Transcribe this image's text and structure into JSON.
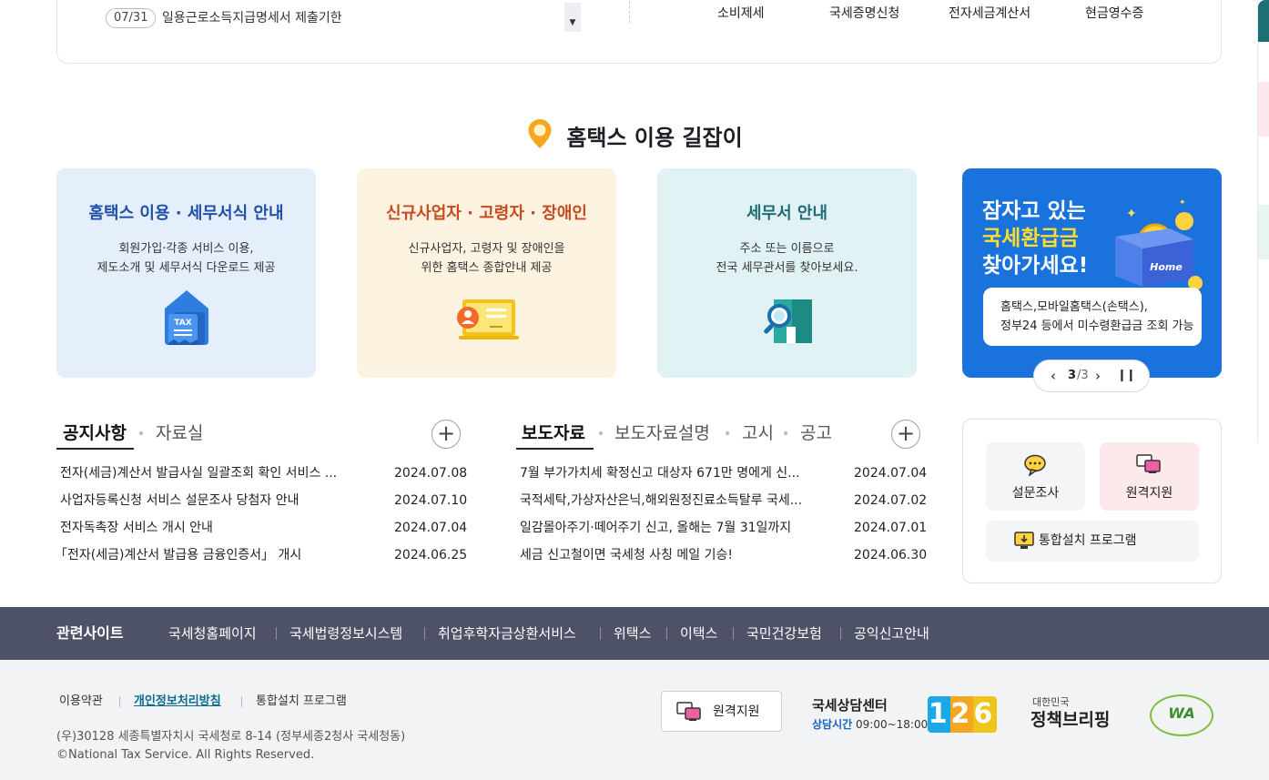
{
  "schedule": {
    "date": "07/31",
    "text": "일용근로소득지급명세서 제출기한",
    "scroll_icon": "triangle-down"
  },
  "top_links": [
    "소비제세",
    "국세증명신청",
    "전자세금계산서",
    "현금영수증"
  ],
  "guide": {
    "title": "홈택스 이용 길잡이",
    "icon": "map-pin-icon",
    "cards": [
      {
        "title": "홈택스 이용 · 세무서식 안내",
        "desc": "회원가입·각종 서비스 이용,\n제도소개 및 세무서식 다운로드 제공",
        "title_color": "#1f4fa8",
        "bg": "#e4effb",
        "icon": "tax-document-icon",
        "icon_text": "TAX"
      },
      {
        "title": "신규사업자 · 고령자 · 장애인",
        "desc": "신규사업자, 고령자 및 장애인을\n위한 홈택스 종합안내 제공",
        "title_color": "#c74b1e",
        "bg": "#fbf3df",
        "icon": "monitor-person-icon"
      },
      {
        "title": "세무서 안내",
        "desc": "주소 또는 이름으로\n전국 세무관서를 찾아보세요.",
        "title_color": "#1f6b77",
        "bg": "#e0f2f3",
        "icon": "building-search-icon"
      }
    ]
  },
  "banner": {
    "line1": "잠자고 있는",
    "line2": "국세환급금",
    "line3": "찾아가세요!",
    "box_text": "홈택스,모바일홈택스(손택스),\n정부24 등에서 미수령환급금 조회 가능",
    "icon": "coin-box-icon",
    "home_label": "Home",
    "pager": {
      "current": "3",
      "total": "/3"
    },
    "colors": {
      "bg": "#1a73dc",
      "highlight": "#ffdd2a"
    }
  },
  "notice_board": {
    "tabs": [
      "공지사항",
      "자료실"
    ],
    "rows": [
      {
        "title": "전자(세금)계산서 발급사실 일괄조회 확인 서비스 ...",
        "date": "2024.07.08"
      },
      {
        "title": "사업자등록신청 서비스 설문조사 당첨자 안내",
        "date": "2024.07.10"
      },
      {
        "title": "전자독촉장 서비스 개시 안내",
        "date": "2024.07.04"
      },
      {
        "title": "「전자(세금)계산서 발급용 금융인증서」 개시",
        "date": "2024.06.25"
      }
    ]
  },
  "press_board": {
    "tabs": [
      "보도자료",
      "보도자료설명",
      "고시",
      "공고"
    ],
    "rows": [
      {
        "title": "7월 부가가치세 확정신고 대상자 671만 명에게 신...",
        "date": "2024.07.04"
      },
      {
        "title": "국적세탁,가상자산은닉,해외원정진료소득탈루 국세...",
        "date": "2024.07.02"
      },
      {
        "title": "일감몰아주기·떼어주기 신고, 올해는 7월 31일까지",
        "date": "2024.07.01"
      },
      {
        "title": "세금 신고철이면 국세청 사칭 메일 기승!",
        "date": "2024.06.30"
      }
    ]
  },
  "quick": {
    "survey": "설문조사",
    "remote": "원격지원",
    "install": "통합설치 프로그램"
  },
  "related": {
    "title": "관련사이트",
    "links": [
      "국세청홈페이지",
      "국세법령정보시스템",
      "취업후학자금상환서비스",
      "위택스",
      "이택스",
      "국민건강보험",
      "공익신고안내"
    ]
  },
  "footer": {
    "links": [
      "이용약관",
      "개인정보처리방침",
      "통합설치 프로그램"
    ],
    "address": "(우)30128 세종특별자치시 국세청로 8-14 (정부세종2청사 국세청동)",
    "copyright": "©National Tax Service. All Rights Reserved.",
    "remote_button": "원격지원",
    "center_title": "국세상담센터",
    "hours_label": "상담시간",
    "hours": "09:00~18:00",
    "phone_logo": "126",
    "policy_small": "대한민국",
    "policy_logo": "정책브리핑",
    "wa_logo": "WA"
  }
}
